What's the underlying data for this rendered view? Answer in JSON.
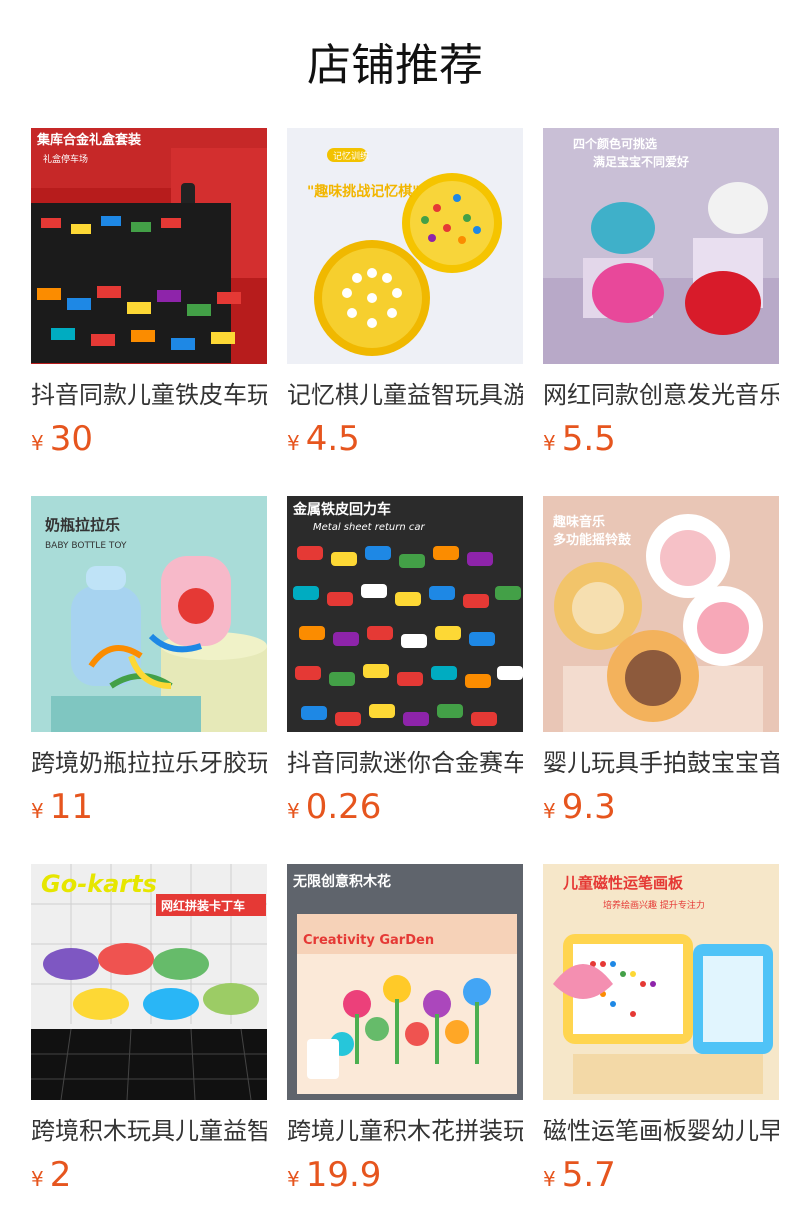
{
  "header": {
    "title": "店铺推荐"
  },
  "products": [
    {
      "name": "抖音同款儿童铁皮车玩具",
      "currency": "¥",
      "price": "30",
      "image": {
        "icon": "toy-car-gift-box-image",
        "bg": "#c62828",
        "overlay_top": "集库合金礼盒套装",
        "overlay_sub": "礼盒停车场"
      }
    },
    {
      "name": "记忆棋儿童益智玩具游戏",
      "currency": "¥",
      "price": "4.5",
      "image": {
        "icon": "memory-chess-image",
        "bg": "#eef0f6",
        "overlay_top": "\"趣味挑战记忆棋\"",
        "overlay_sub": "记忆训练"
      }
    },
    {
      "name": "网红同款创意发光音乐小猪",
      "currency": "¥",
      "price": "5.5",
      "image": {
        "icon": "piggy-toy-image",
        "bg": "#c9bfd6",
        "overlay_top": "四个颜色可挑选",
        "overlay_sub": "满足宝宝不同爱好"
      }
    },
    {
      "name": "跨境奶瓶拉拉乐牙胶玩具",
      "currency": "¥",
      "price": "11",
      "image": {
        "icon": "baby-bottle-toy-image",
        "bg": "#a9dcd8",
        "overlay_top": "奶瓶拉拉乐",
        "overlay_sub": "BABY BOTTLE TOY"
      }
    },
    {
      "name": "抖音同款迷你合金赛车玩具",
      "currency": "¥",
      "price": "0.26",
      "image": {
        "icon": "metal-cars-image",
        "bg": "#2b2b2b",
        "overlay_top": "金属铁皮回力车",
        "overlay_sub": "Metal sheet return car"
      }
    },
    {
      "name": "婴儿玩具手拍鼓宝宝音乐",
      "currency": "¥",
      "price": "9.3",
      "image": {
        "icon": "hand-drum-toy-image",
        "bg": "#e9c6b6",
        "overlay_top": "趣味音乐",
        "overlay_sub": "多功能摇铃鼓"
      }
    },
    {
      "name": "跨境积木玩具儿童益智卡丁车",
      "currency": "¥",
      "price": "2",
      "image": {
        "icon": "go-kart-toy-image",
        "bg": "#efefef",
        "overlay_top": "Go-karts",
        "overlay_sub": "网红拼装卡丁车"
      }
    },
    {
      "name": "跨境儿童积木花拼装玩具",
      "currency": "¥",
      "price": "19.9",
      "image": {
        "icon": "flower-blocks-image",
        "bg": "#6a6f77",
        "overlay_top": "无限创意积木花",
        "overlay_sub": "Creativity GarDen"
      }
    },
    {
      "name": "磁性运笔画板婴幼儿早教",
      "currency": "¥",
      "price": "5.7",
      "image": {
        "icon": "magnetic-drawing-board-image",
        "bg": "#f6e7c9",
        "overlay_top": "儿童磁性运笔画板",
        "overlay_sub": "培养绘画兴趣 提升专注力"
      }
    }
  ],
  "colors": {
    "price": "#e6551e",
    "title": "#111111",
    "name": "#333333"
  }
}
